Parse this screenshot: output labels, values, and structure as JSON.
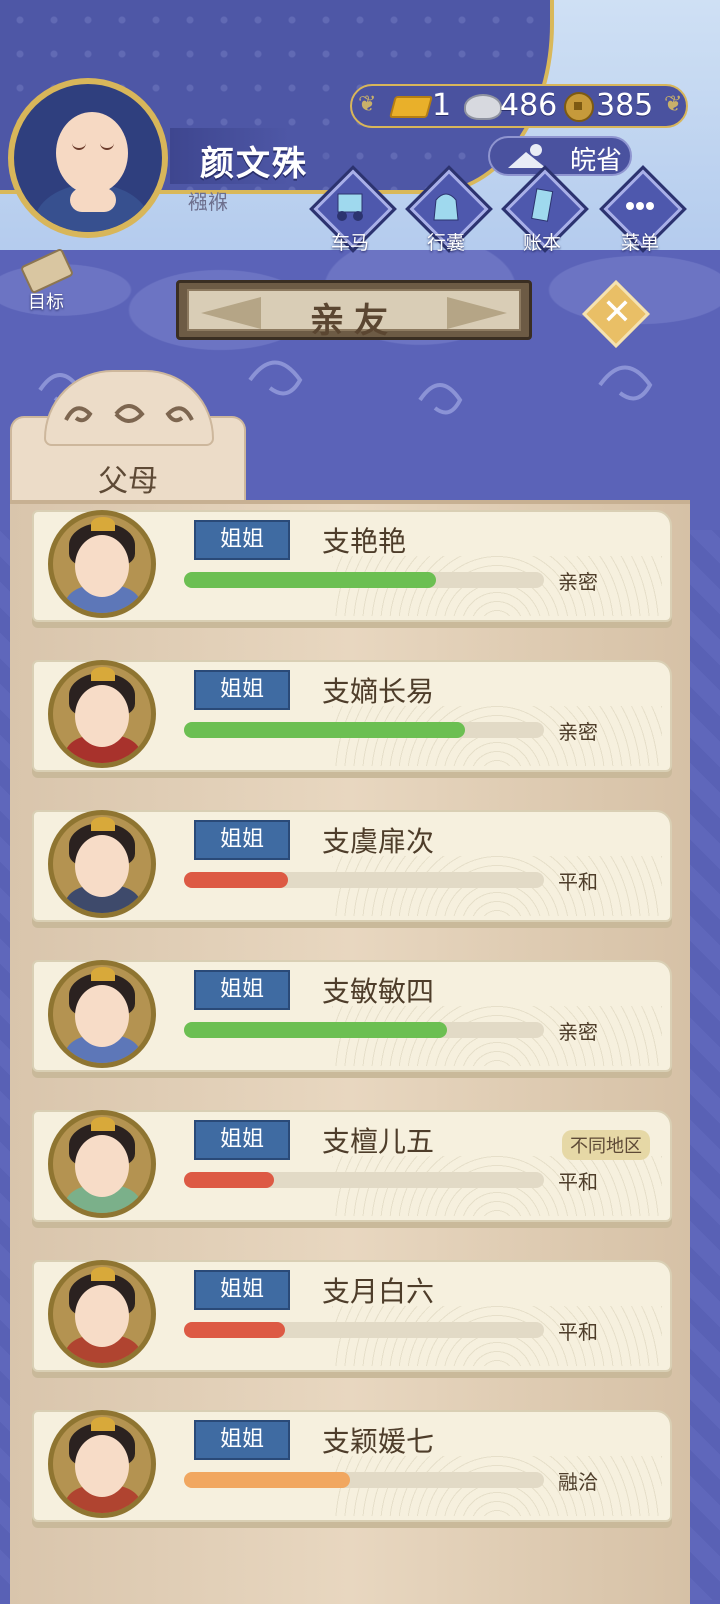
{
  "player": {
    "name": "颜文殊",
    "stage": "襁褓"
  },
  "currency": {
    "gold": "1",
    "silver": "486",
    "coins": "385"
  },
  "location": {
    "name": "皖省"
  },
  "menu": [
    {
      "label": "车马",
      "icon": "carriage-icon"
    },
    {
      "label": "行囊",
      "icon": "bag-icon"
    },
    {
      "label": "账本",
      "icon": "ledger-icon"
    },
    {
      "label": "菜单",
      "icon": "more-icon"
    }
  ],
  "goal_label": "目标",
  "title": "亲友",
  "category_tab": "父母",
  "colors": {
    "green": "#6cbf52",
    "red": "#dd5a44",
    "orange": "#f1a760",
    "relation_badge": "#3f6ba2"
  },
  "relatives": [
    {
      "relation": "姐姐",
      "name": "支艳艳",
      "status": "亲密",
      "affinity": 0.7,
      "bar_color": "#6cbf52",
      "robe": "#5d77b8",
      "tag": ""
    },
    {
      "relation": "姐姐",
      "name": "支嫡长易",
      "status": "亲密",
      "affinity": 0.78,
      "bar_color": "#6cbf52",
      "robe": "#a8322c",
      "tag": ""
    },
    {
      "relation": "姐姐",
      "name": "支虞扉次",
      "status": "平和",
      "affinity": 0.29,
      "bar_color": "#dd5a44",
      "robe": "#3e4a6b",
      "tag": ""
    },
    {
      "relation": "姐姐",
      "name": "支敏敏四",
      "status": "亲密",
      "affinity": 0.73,
      "bar_color": "#6cbf52",
      "robe": "#5d77b8",
      "tag": ""
    },
    {
      "relation": "姐姐",
      "name": "支檀儿五",
      "status": "平和",
      "affinity": 0.25,
      "bar_color": "#dd5a44",
      "robe": "#7bb08a",
      "tag": "不同地区"
    },
    {
      "relation": "姐姐",
      "name": "支月白六",
      "status": "平和",
      "affinity": 0.28,
      "bar_color": "#dd5a44",
      "robe": "#b04430",
      "tag": ""
    },
    {
      "relation": "姐姐",
      "name": "支颖媛七",
      "status": "融洽",
      "affinity": 0.46,
      "bar_color": "#f1a760",
      "robe": "#b04430",
      "tag": ""
    }
  ]
}
